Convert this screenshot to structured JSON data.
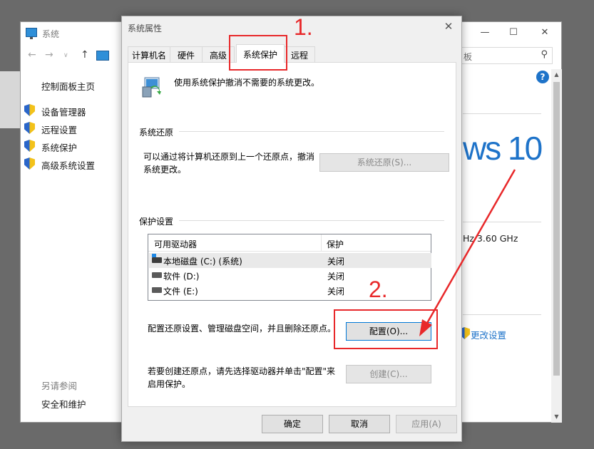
{
  "system_window": {
    "title": "系统",
    "search_placeholder": "板",
    "sidebar_home": "控制面板主页",
    "sidebar_links": [
      {
        "label": "设备管理器",
        "icon": "shield-icon"
      },
      {
        "label": "远程设置",
        "icon": "shield-icon"
      },
      {
        "label": "系统保护",
        "icon": "shield-icon"
      },
      {
        "label": "高级系统设置",
        "icon": "shield-icon"
      }
    ],
    "see_also": "另请参阅",
    "security_link": "安全和维护",
    "windows_logo_text": "ws 10",
    "cpu_text": "Hz   3.60 GHz",
    "change_settings": "更改设置",
    "help": "?"
  },
  "dialog": {
    "title": "系统属性",
    "tabs": [
      "计算机名",
      "硬件",
      "高级",
      "系统保护",
      "远程"
    ],
    "active_tab": "系统保护",
    "intro_text": "使用系统保护撤消不需要的系统更改。",
    "restore_group": "系统还原",
    "restore_desc": "可以通过将计算机还原到上一个还原点，撤消系统更改。",
    "restore_button": "系统还原(S)...",
    "protection_group": "保护设置",
    "columns": [
      "可用驱动器",
      "保护"
    ],
    "drives": [
      {
        "name": "本地磁盘 (C:) (系统)",
        "protection": "关闭"
      },
      {
        "name": "软件 (D:)",
        "protection": "关闭"
      },
      {
        "name": "文件 (E:)",
        "protection": "关闭"
      }
    ],
    "configure_desc": "配置还原设置、管理磁盘空间，并且删除还原点。",
    "configure_button": "配置(O)...",
    "create_desc": "若要创建还原点，请先选择驱动器并单击\"配置\"来启用保护。",
    "create_button": "创建(C)...",
    "ok_button": "确定",
    "cancel_button": "取消",
    "apply_button": "应用(A)"
  },
  "annotations": {
    "step1": "1.",
    "step2": "2.",
    "color": "#e8282a"
  }
}
